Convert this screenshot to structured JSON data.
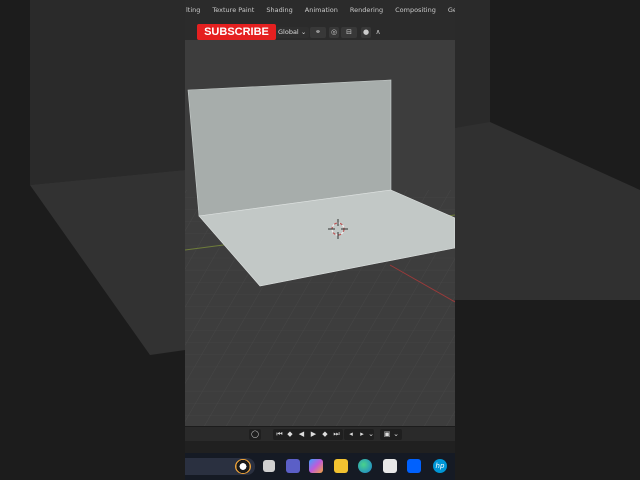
{
  "app": "Blender",
  "topbar": {
    "tabs": [
      "lting",
      "Texture Paint",
      "Shading",
      "Animation",
      "Rendering",
      "Compositing",
      "Geometry No"
    ],
    "subscribe_label": "SUBSCRIBE",
    "transform_orientation": "Global"
  },
  "timeline": {
    "controls": [
      "record-icon",
      "jump-start-icon",
      "prev-keyframe-icon",
      "play-reverse-icon",
      "play-icon",
      "next-keyframe-icon",
      "jump-end-icon",
      "keyframe-prev-icon",
      "keyframe-next-icon",
      "keying-icon"
    ]
  },
  "taskbar": {
    "icons": [
      "search-box",
      "task-view-icon",
      "teams-icon",
      "copilot-icon",
      "file-explorer-icon",
      "edge-icon",
      "store-icon",
      "dropbox-icon",
      "hp-icon"
    ]
  },
  "colors": {
    "subscribe_red": "#e52020",
    "viewport_bg": "#3d3d3d",
    "wall": "#a7adab",
    "floor": "#c2c8c6",
    "x_axis": "#9a3a3a",
    "y_axis": "#6e7d3a"
  }
}
